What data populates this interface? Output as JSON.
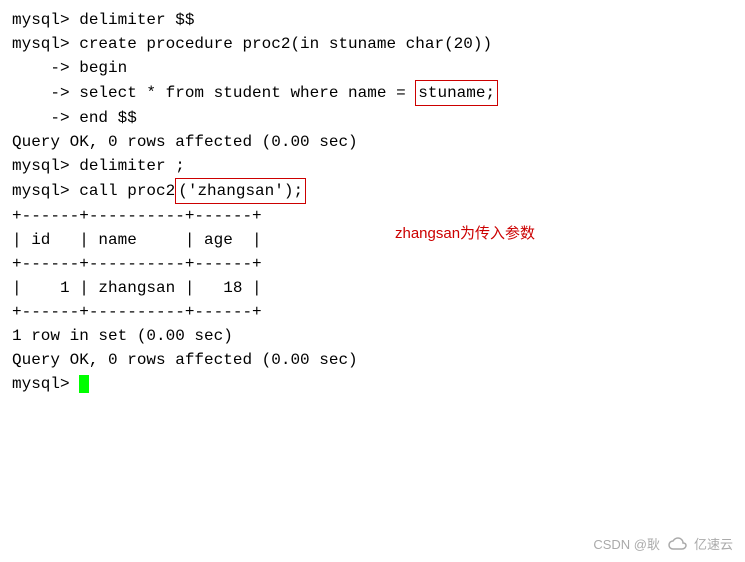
{
  "lines": {
    "l1": "mysql> delimiter $$",
    "l2_prefix": "mysql> create procedure proc2(in stuname char(20))",
    "l3": "    -> begin",
    "l4_prefix": "    -> select * from student where name = ",
    "l4_box": "stuname;",
    "l5": "    -> end $$",
    "l6": "Query OK, 0 rows affected (0.00 sec)",
    "l7": "",
    "l8": "mysql> delimiter ;",
    "l9_prefix": "mysql> call proc2",
    "l9_box": "('zhangsan');",
    "l10": "+------+----------+------+",
    "l11": "| id   | name     | age  |",
    "l12": "+------+----------+------+",
    "l13": "|    1 | zhangsan |   18 |",
    "l14": "+------+----------+------+",
    "l15": "1 row in set (0.00 sec)",
    "l16": "",
    "l17": "Query OK, 0 rows affected (0.00 sec)",
    "l18": "",
    "l19": "mysql> "
  },
  "annotation": "zhangsan为传入参数",
  "watermark": {
    "text1": "CSDN @耿",
    "text2": "亿速云"
  },
  "chart_data": {
    "type": "table",
    "title": "student query result",
    "columns": [
      "id",
      "name",
      "age"
    ],
    "rows": [
      {
        "id": 1,
        "name": "zhangsan",
        "age": 18
      }
    ]
  }
}
